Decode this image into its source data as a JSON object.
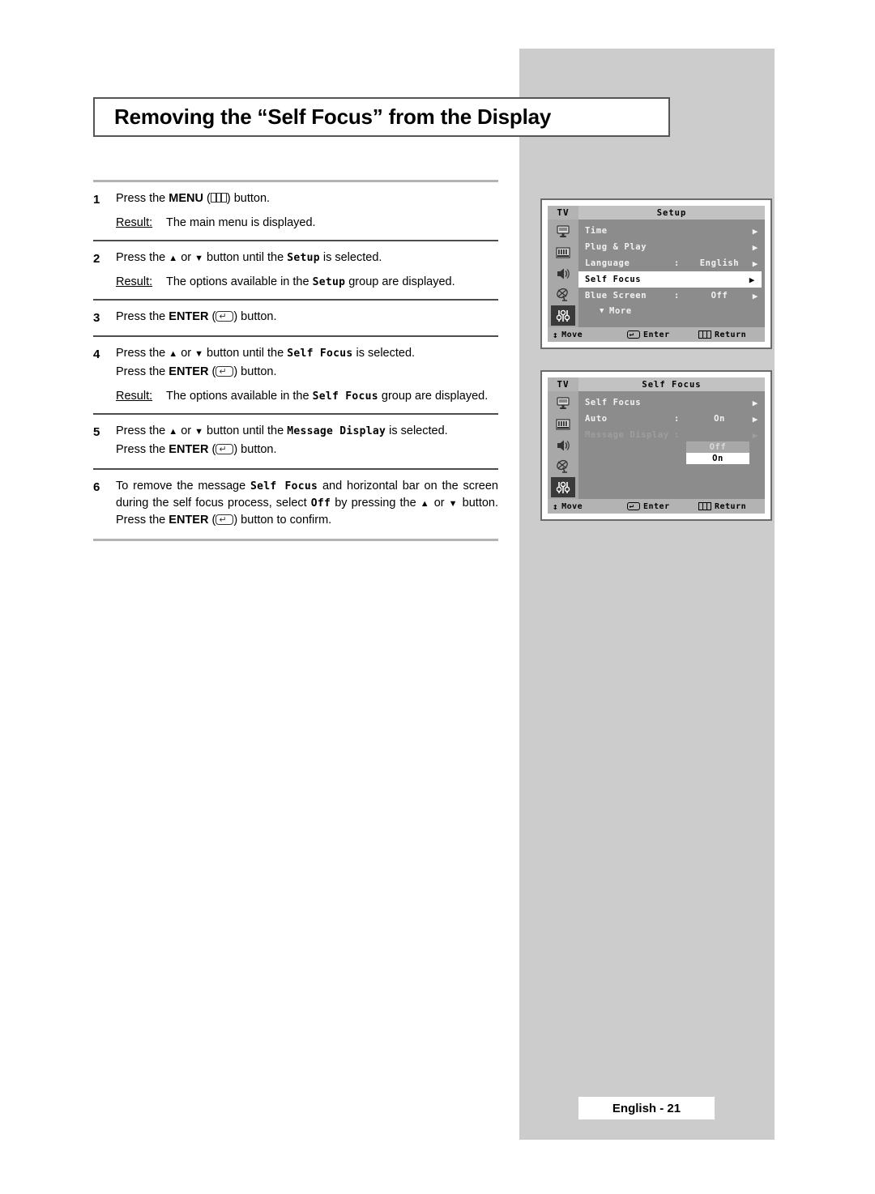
{
  "page": {
    "title": "Removing the “Self Focus” from the Display",
    "footer_label": "English - 21"
  },
  "steps": [
    {
      "num": "1",
      "line1_a": "Press the ",
      "line1_menu": "MENU",
      "line1_b": " button.",
      "result_label": "Result:",
      "result_text": "The main menu is displayed."
    },
    {
      "num": "2",
      "line1_a": "Press the ",
      "line1_b": " or ",
      "line1_c": " button until the ",
      "line1_mono": "Setup",
      "line1_d": " is selected.",
      "result_label": "Result:",
      "result_a": "The options available in the ",
      "result_mono": "Setup",
      "result_b": " group are displayed."
    },
    {
      "num": "3",
      "line1_a": "Press the ",
      "line1_enter": "ENTER",
      "line1_b": " button."
    },
    {
      "num": "4",
      "line1_a": "Press the ",
      "line1_b": " or ",
      "line1_c": " button until the ",
      "line1_mono": "Self Focus",
      "line1_d": " is selected.",
      "line2_a": "Press the ",
      "line2_enter": "ENTER",
      "line2_b": " button.",
      "result_label": "Result:",
      "result_a": "The options available in the ",
      "result_mono": "Self Focus",
      "result_b": " group are displayed."
    },
    {
      "num": "5",
      "line1_a": "Press the ",
      "line1_b": " or ",
      "line1_c": " button until the ",
      "line1_mono": "Message Display",
      "line1_d": " is selected.",
      "line2_a": "Press the ",
      "line2_enter": "ENTER",
      "line2_b": " button."
    },
    {
      "num": "6",
      "t_a": "To remove the message ",
      "t_mono1": "Self Focus",
      "t_b": " and horizontal bar on the screen during the self focus process, select ",
      "t_mono2": "Off",
      "t_c": " by pressing the ",
      "t_d": " or ",
      "t_e": " button. Press the ",
      "t_enter": "ENTER",
      "t_f": " button to confirm."
    }
  ],
  "tv_menu_1": {
    "tv_label": "TV",
    "heading": "Setup",
    "rows": [
      {
        "label": "Time",
        "colon": "",
        "value": "",
        "arrow": "▶",
        "selected": false,
        "dim": false
      },
      {
        "label": "Plug & Play",
        "colon": "",
        "value": "",
        "arrow": "▶",
        "selected": false,
        "dim": false
      },
      {
        "label": "Language",
        "colon": ":",
        "value": "English",
        "arrow": "▶",
        "selected": false,
        "dim": false
      },
      {
        "label": "Self Focus",
        "colon": "",
        "value": "",
        "arrow": "▶",
        "selected": true,
        "dim": false
      },
      {
        "label": "Blue Screen",
        "colon": ":",
        "value": "Off",
        "arrow": "▶",
        "selected": false,
        "dim": false
      }
    ],
    "more_label": "More",
    "more_icon": "▼",
    "footer": {
      "move": "Move",
      "enter": "Enter",
      "return": "Return"
    },
    "side_icons": [
      "picture-icon",
      "bars-icon",
      "speaker-icon",
      "satellite-dish-icon",
      "sliders-icon"
    ]
  },
  "tv_menu_2": {
    "tv_label": "TV",
    "heading": "Self Focus",
    "rows": [
      {
        "label": "Self Focus",
        "colon": "",
        "value": "",
        "arrow": "▶",
        "selected": false,
        "dim": false
      },
      {
        "label": "Auto",
        "colon": ":",
        "value": "On",
        "arrow": "▶",
        "selected": false,
        "dim": false
      },
      {
        "label": "Message Display",
        "colon": ":",
        "value": "",
        "arrow": "▶",
        "selected": false,
        "dim": true
      }
    ],
    "dropdown": {
      "option_off": "Off",
      "option_on": "On"
    },
    "footer": {
      "move": "Move",
      "enter": "Enter",
      "return": "Return"
    },
    "side_icons": [
      "picture-icon",
      "bars-icon",
      "speaker-icon",
      "satellite-dish-icon",
      "sliders-icon"
    ]
  },
  "glyphs": {
    "up_triangle": "▲",
    "down_triangle": "▼",
    "updown": "↕",
    "paren_open": "(",
    "paren_close": ")"
  },
  "colors": {
    "panel_gray": "#cccccc",
    "menu_body": "#8c8c8c",
    "menu_header": "#c2c2c2",
    "menu_footer": "#b3b3b3",
    "selected_row": "#ffffff"
  }
}
